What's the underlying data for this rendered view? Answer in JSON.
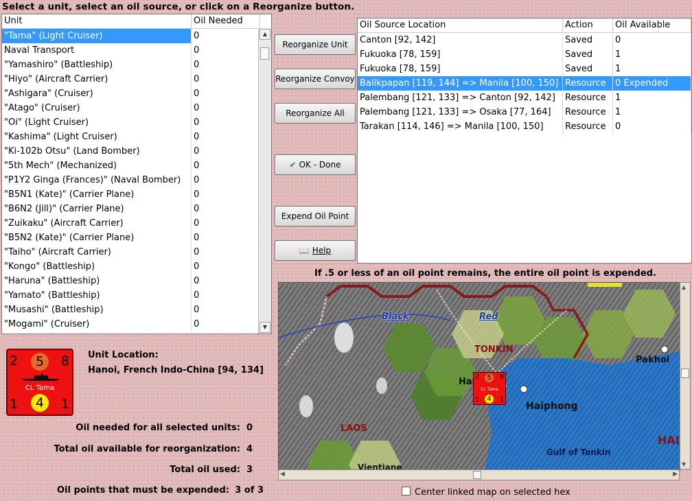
{
  "instruction": "Select a unit, select an oil source, or click on a Reorganize button.",
  "units_table": {
    "headers": [
      "Unit",
      "Oil Needed"
    ],
    "rows": [
      [
        "\"Tama\" (Light Cruiser)",
        "0"
      ],
      [
        "Naval Transport",
        "0"
      ],
      [
        "\"Yamashiro\" (Battleship)",
        "0"
      ],
      [
        "\"Hiyo\" (Aircraft Carrier)",
        "0"
      ],
      [
        "\"Ashigara\" (Cruiser)",
        "0"
      ],
      [
        "\"Atago\" (Cruiser)",
        "0"
      ],
      [
        "\"Oi\" (Light Cruiser)",
        "0"
      ],
      [
        "\"Kashima\" (Light Cruiser)",
        "0"
      ],
      [
        "\"Ki-102b Otsu\" (Land Bomber)",
        "0"
      ],
      [
        "\"5th Mech\" (Mechanized)",
        "0"
      ],
      [
        "\"P1Y2 Ginga (Frances)\" (Naval Bomber)",
        "0"
      ],
      [
        "\"B5N1 (Kate)\" (Carrier Plane)",
        "0"
      ],
      [
        "\"B6N2 (Jill)\" (Carrier Plane)",
        "0"
      ],
      [
        "\"Zuikaku\" (Aircraft Carrier)",
        "0"
      ],
      [
        "\"B5N2 (Kate)\" (Carrier Plane)",
        "0"
      ],
      [
        "\"Taiho\" (Aircraft Carrier)",
        "0"
      ],
      [
        "\"Kongo\" (Battleship)",
        "0"
      ],
      [
        "\"Haruna\" (Battleship)",
        "0"
      ],
      [
        "\"Yamato\" (Battleship)",
        "0"
      ],
      [
        "\"Musashi\" (Battleship)",
        "0"
      ],
      [
        "\"Mogami\" (Cruiser)",
        "0"
      ]
    ],
    "selected_row": 0
  },
  "buttons": {
    "reorganize_unit": "Reorganize Unit",
    "reorganize_convoy": "Reorganize Convoy",
    "reorganize_all": "Reorganize All",
    "ok_done": "OK - Done",
    "expend_oil_point": "Expend Oil Point",
    "help": "Help"
  },
  "oil_table": {
    "headers": [
      "Oil Source Location",
      "Action",
      "Oil Available"
    ],
    "rows": [
      [
        "Canton [92, 142]",
        "Saved",
        "0"
      ],
      [
        "Fukuoka [78, 159]",
        "Saved",
        "1"
      ],
      [
        "Fukuoka [78, 159]",
        "Saved",
        "1"
      ],
      [
        "Balikpapan [119, 144] => Manila [100, 150]",
        "Resource",
        "0 Expended"
      ],
      [
        "Palembang [121, 133] => Canton [92, 142]",
        "Resource",
        "1"
      ],
      [
        "Palembang [121, 133] => Osaka [77, 164]",
        "Resource",
        "1"
      ],
      [
        "Tarakan [114, 146] => Manila [100, 150]",
        "Resource",
        "0"
      ]
    ],
    "selected_row": 3
  },
  "note": "If .5 or less of an oil point remains, the entire oil point is expended.",
  "map": {
    "labels": {
      "black": "Black",
      "red": "Red",
      "tonkin": "TONKIN",
      "hanoi_partial": "Han",
      "haiphong": "Haiphong",
      "pakhoi": "Pakhoi",
      "laos": "LAOS",
      "gulf": "Gulf of Tonkin",
      "hai_partial": "HAI",
      "vientiane_partial": "Vientiane"
    }
  },
  "counter": {
    "top_left": "2",
    "top_mid": "5",
    "top_right": "8",
    "name": "CL Tama",
    "bottom_left": "1",
    "bottom_mid": "4",
    "bottom_right": "1",
    "color": "#ee1111"
  },
  "unit_location": {
    "label": "Unit Location:",
    "value": "Hanoi, French Indo-China [94, 134]"
  },
  "stats": {
    "oil_needed_label": "Oil needed for all selected units:",
    "oil_needed_value": "0",
    "total_available_label": "Total oil available for reorganization:",
    "total_available_value": "4",
    "total_used_label": "Total oil used:",
    "total_used_value": "3",
    "must_expend_label": "Oil points that must be expended:",
    "must_expend_value": "3 of 3"
  },
  "center_checkbox_label": "Center linked map on selected hex",
  "center_checkbox_checked": false,
  "icons": {
    "ok": "checkmark-icon",
    "help": "book-icon"
  }
}
